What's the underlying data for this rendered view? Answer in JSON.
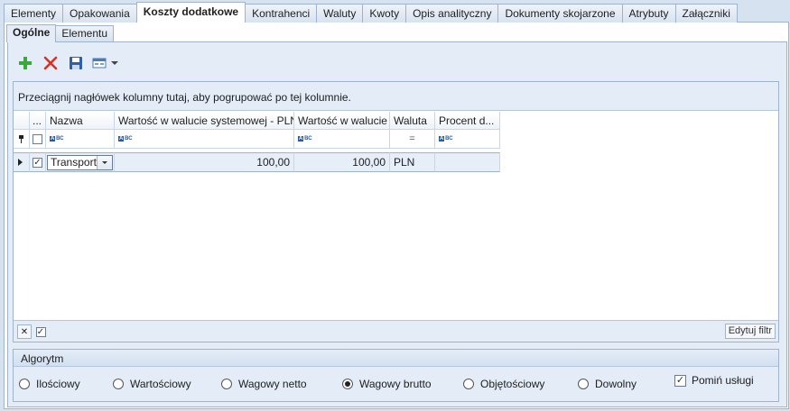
{
  "top_tabs": [
    "Elementy",
    "Opakowania",
    "Koszty dodatkowe",
    "Kontrahenci",
    "Waluty",
    "Kwoty",
    "Opis analityczny",
    "Dokumenty skojarzone",
    "Atrybuty",
    "Załączniki"
  ],
  "sub_tabs": [
    "Ogólne",
    "Elementu"
  ],
  "grid": {
    "group_hint": "Przeciągnij nagłówek kolumny tutaj, aby pogrupować po tej kolumnie.",
    "columns": [
      "...",
      "Nazwa",
      "Wartość w walucie systemowej - PLN",
      "Wartość w walucie",
      "Waluta",
      "Procent d..."
    ],
    "rows": [
      {
        "checked": true,
        "nazwa": "Transport",
        "wartosc_pln": "100,00",
        "wartosc_waluta": "100,00",
        "waluta": "PLN",
        "procent": ""
      }
    ],
    "edit_filter_label": "Edytuj filtr",
    "abc_label": "ABC"
  },
  "algorithm": {
    "title": "Algorytm",
    "options": [
      "Ilościowy",
      "Wartościowy",
      "Wagowy netto",
      "Wagowy brutto",
      "Objętościowy",
      "Dowolny"
    ],
    "selected": "Wagowy brutto",
    "skip_services_label": "Pomiń usługi",
    "skip_services_checked": true
  },
  "colors": {
    "accent": "#2a5aa0",
    "add_green": "#3aa83a",
    "delete_red": "#d93025"
  },
  "icons": [
    "add-icon",
    "delete-icon",
    "save-icon",
    "export-icon"
  ]
}
